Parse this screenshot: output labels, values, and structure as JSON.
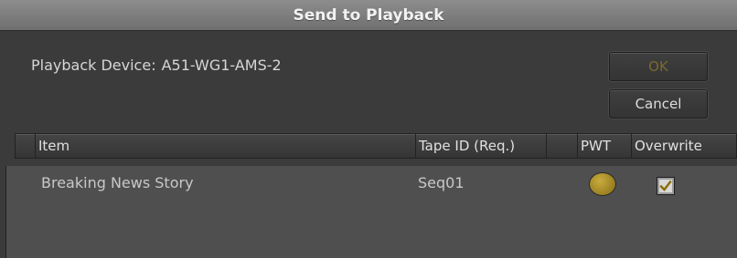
{
  "window": {
    "title": "Send to Playback"
  },
  "device": {
    "label": "Playback Device:",
    "name": "A51-WG1-AMS-2"
  },
  "buttons": {
    "ok_label": "OK",
    "cancel_label": "Cancel",
    "ok_enabled": false
  },
  "table": {
    "columns": {
      "item": "Item",
      "tape_id": "Tape ID (Req.)",
      "pwt": "PWT",
      "overwrite": "Overwrite"
    },
    "rows": [
      {
        "item": "Breaking News Story",
        "tape_id": "Seq01",
        "pwt_state": "active",
        "overwrite": true
      }
    ]
  },
  "colors": {
    "ok_disabled_text": "#7a6a2e",
    "pwt_indicator": "#b3962f",
    "checkmark": "#8a6c00"
  },
  "icons": {
    "pwt": "circle-indicator-icon",
    "overwrite": "checkmark-icon"
  }
}
